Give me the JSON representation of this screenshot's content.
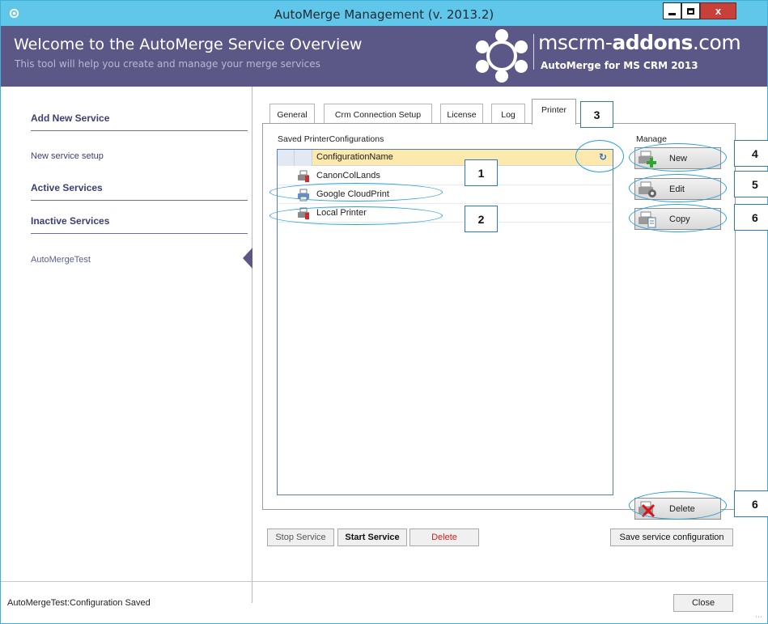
{
  "window": {
    "title": "AutoMerge Management (v. 2013.2)",
    "close_glyph": "x"
  },
  "header": {
    "title": "Welcome to the AutoMerge Service Overview",
    "subtitle": "This tool will help you create and manage your merge services",
    "brand_prefix": "mscrm-",
    "brand_bold": "addons",
    "brand_suffix": ".com",
    "brand_tagline": "AutoMerge for MS CRM 2013",
    "brand_color": "#5b5887"
  },
  "sidebar": {
    "add_new_heading": "Add New Service",
    "new_service_link": "New service setup",
    "active_heading": "Active Services",
    "inactive_heading": "Inactive Services",
    "inactive_items": [
      "AutoMergeTest"
    ]
  },
  "tabs": [
    {
      "label": "General",
      "active": false
    },
    {
      "label": "Crm Connection Setup",
      "active": false
    },
    {
      "label": "License",
      "active": false
    },
    {
      "label": "Log",
      "active": false
    },
    {
      "label": "Printer",
      "active": true
    }
  ],
  "printer": {
    "group_label": "Saved PrinterConfigurations",
    "column_header": "ConfigurationName",
    "rows": [
      {
        "name": "CanonColLands",
        "icon": "printer-icon"
      },
      {
        "name": "Google CloudPrint",
        "icon": "cloud-printer-icon"
      },
      {
        "name": "Local Printer",
        "icon": "printer-icon"
      }
    ]
  },
  "manage": {
    "group_label": "Manage",
    "new_label": "New",
    "edit_label": "Edit",
    "copy_label": "Copy",
    "delete_label": "Delete"
  },
  "footer": {
    "stop_label": "Stop Service",
    "start_label": "Start Service",
    "delete_label": "Delete",
    "save_label": "Save service configuration",
    "status_text": "AutoMergeTest:Configuration Saved",
    "close_label": "Close"
  },
  "annotations": {
    "callout_1": "1",
    "callout_2": "2",
    "callout_3": "3",
    "callout_4": "4",
    "callout_5": "5",
    "callout_6a": "6",
    "callout_6b": "6",
    "color": "#2a9fd6"
  }
}
